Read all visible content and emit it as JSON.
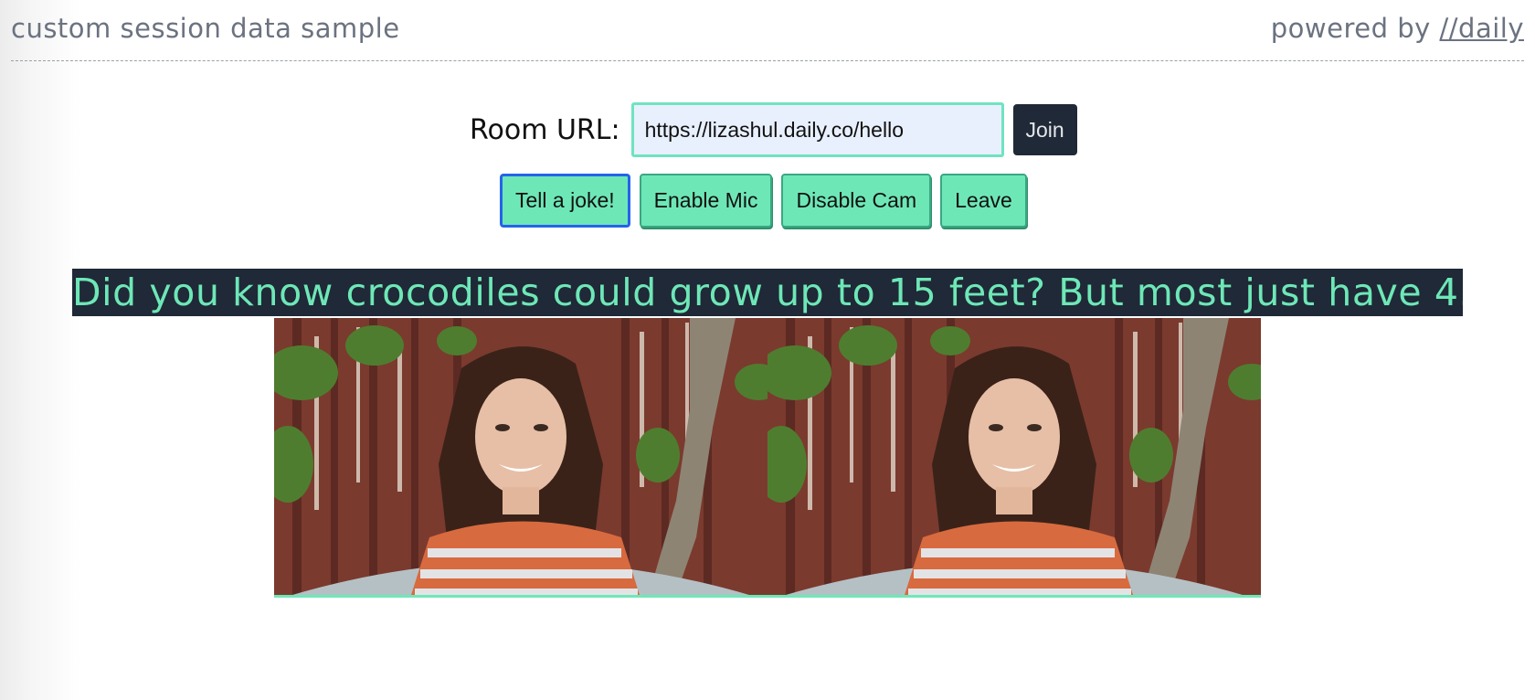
{
  "header": {
    "title": "custom session data sample",
    "powered_prefix": "powered by ",
    "powered_link": "//daily"
  },
  "room": {
    "label": "Room URL:",
    "url_value": "https://lizashul.daily.co/hello",
    "join_label": "Join"
  },
  "controls": {
    "joke_label": "Tell a joke!",
    "mic_label": "Enable Mic",
    "cam_label": "Disable Cam",
    "leave_label": "Leave"
  },
  "joke": {
    "text": "Did you know crocodiles could grow up to 15 feet? But most just have 4."
  },
  "colors": {
    "accent": "#6ee7b7",
    "dark": "#1f2937",
    "focus": "#2563eb",
    "muted_text": "#6b7280"
  }
}
